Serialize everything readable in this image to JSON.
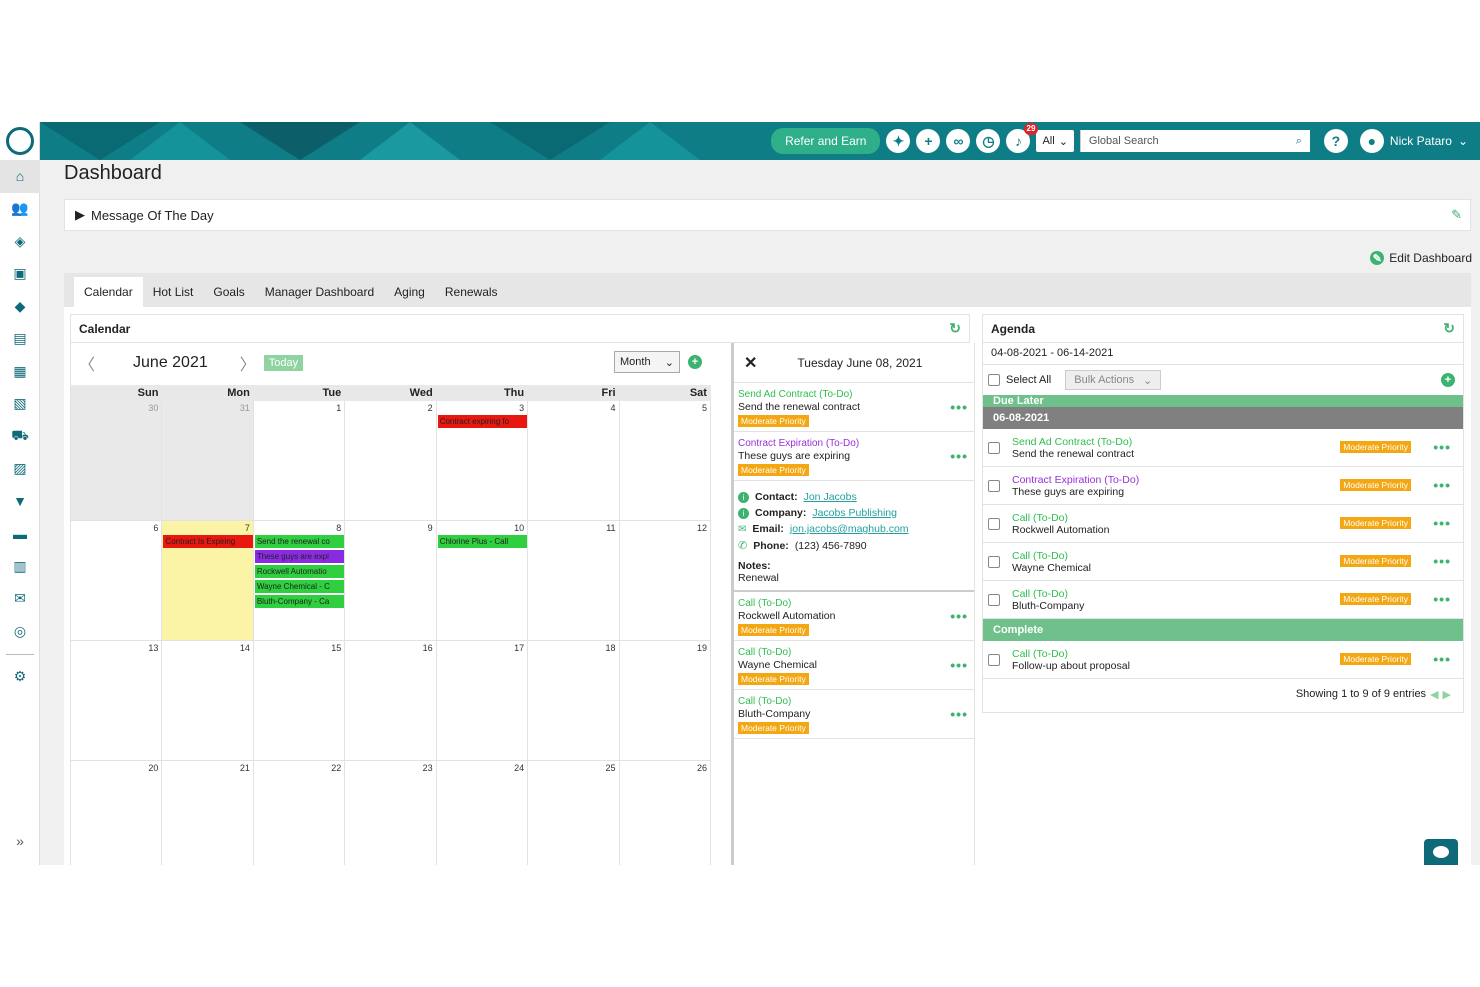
{
  "topbar": {
    "refer": "Refer and Earn",
    "notif_count": "29",
    "scope": "All",
    "search_placeholder": "Global Search",
    "user": "Nick Pataro"
  },
  "page": {
    "title": "Dashboard",
    "motd": "Message Of The Day",
    "edit": "Edit Dashboard"
  },
  "tabs": [
    {
      "label": "Calendar"
    },
    {
      "label": "Hot List"
    },
    {
      "label": "Goals"
    },
    {
      "label": "Manager Dashboard"
    },
    {
      "label": "Aging"
    },
    {
      "label": "Renewals"
    }
  ],
  "calendar": {
    "title": "Calendar",
    "month": "June 2021",
    "today": "Today",
    "view": "Month",
    "dow": [
      "Sun",
      "Mon",
      "Tue",
      "Wed",
      "Thu",
      "Fri",
      "Sat"
    ],
    "weeks": [
      [
        {
          "n": "30",
          "o": true
        },
        {
          "n": "31",
          "o": true
        },
        {
          "n": "1"
        },
        {
          "n": "2"
        },
        {
          "n": "3"
        },
        {
          "n": "4"
        },
        {
          "n": "5"
        }
      ],
      [
        {
          "n": "6"
        },
        {
          "n": "7"
        },
        {
          "n": "8"
        },
        {
          "n": "9"
        },
        {
          "n": "10"
        },
        {
          "n": "11"
        },
        {
          "n": "12"
        }
      ],
      [
        {
          "n": "13"
        },
        {
          "n": "14"
        },
        {
          "n": "15"
        },
        {
          "n": "16"
        },
        {
          "n": "17"
        },
        {
          "n": "18"
        },
        {
          "n": "19"
        }
      ],
      [
        {
          "n": "20"
        },
        {
          "n": "21"
        },
        {
          "n": "22"
        },
        {
          "n": "23"
        },
        {
          "n": "24"
        },
        {
          "n": "25"
        },
        {
          "n": "26"
        }
      ]
    ],
    "events": [
      {
        "week": 0,
        "day": 4,
        "label": "Contract expiring fo",
        "color": "#e8170f"
      },
      {
        "week": 1,
        "day": 1,
        "label": "Contract Is Expiring",
        "color": "#e8170f"
      },
      {
        "week": 1,
        "day": 2,
        "label": "Send the renewal co",
        "color": "#2fcf3f"
      },
      {
        "week": 1,
        "day": 2,
        "label": "These guys are expi",
        "color": "#8a2be2"
      },
      {
        "week": 1,
        "day": 2,
        "label": "Rockwell Automatio",
        "color": "#2fcf3f"
      },
      {
        "week": 1,
        "day": 2,
        "label": "Wayne Chemical - C",
        "color": "#2fcf3f"
      },
      {
        "week": 1,
        "day": 2,
        "label": "Bluth-Company - Ca",
        "color": "#2fcf3f"
      },
      {
        "week": 1,
        "day": 4,
        "label": "Chlorine Plus - Call",
        "color": "#2fcf3f"
      }
    ]
  },
  "detail": {
    "date": "Tuesday June 08, 2021",
    "items_top": [
      {
        "title": "Send Ad Contract (To-Do)",
        "sub": "Send the renewal contract",
        "prio": "Moderate Priority",
        "color": "#2fbf4f"
      },
      {
        "title": "Contract Expiration (To-Do)",
        "sub": "These guys are expiring",
        "prio": "Moderate Priority",
        "color": "#9a30d8"
      }
    ],
    "contact": {
      "contact_label": "Contact:",
      "contact": "Jon Jacobs",
      "company_label": "Company:",
      "company": "Jacobs Publishing",
      "email_label": "Email:",
      "email": "jon.jacobs@maghub.com",
      "phone_label": "Phone:",
      "phone": "(123) 456-7890",
      "notes_label": "Notes:",
      "notes": "Renewal"
    },
    "items_bottom": [
      {
        "title": "Call (To-Do)",
        "sub": "Rockwell Automation",
        "prio": "Moderate Priority",
        "color": "#2fbf4f"
      },
      {
        "title": "Call (To-Do)",
        "sub": "Wayne Chemical",
        "prio": "Moderate Priority",
        "color": "#2fbf4f"
      },
      {
        "title": "Call (To-Do)",
        "sub": "Bluth-Company",
        "prio": "Moderate Priority",
        "color": "#2fbf4f"
      }
    ]
  },
  "agenda": {
    "title": "Agenda",
    "range": "04-08-2021 - 06-14-2021",
    "select_all": "Select All",
    "bulk": "Bulk Actions",
    "due_later": "Due Later",
    "date_group": "06-08-2021",
    "complete": "Complete",
    "rows": [
      {
        "title": "Send Ad Contract (To-Do)",
        "sub": "Send the renewal contract",
        "prio": "Moderate Priority",
        "color": "#2fbf4f"
      },
      {
        "title": "Contract Expiration (To-Do)",
        "sub": "These guys are expiring",
        "prio": "Moderate Priority",
        "color": "#9a30d8"
      },
      {
        "title": "Call (To-Do)",
        "sub": "Rockwell Automation",
        "prio": "Moderate Priority",
        "color": "#2fbf4f"
      },
      {
        "title": "Call (To-Do)",
        "sub": "Wayne Chemical",
        "prio": "Moderate Priority",
        "color": "#2fbf4f"
      },
      {
        "title": "Call (To-Do)",
        "sub": "Bluth-Company",
        "prio": "Moderate Priority",
        "color": "#2fbf4f"
      }
    ],
    "complete_rows": [
      {
        "title": "Call (To-Do)",
        "sub": "Follow-up about proposal",
        "prio": "Moderate Priority",
        "color": "#2fbf4f"
      }
    ],
    "footer": "Showing 1 to 9 of 9 entries"
  },
  "colors": {
    "brand": "#0e7d86",
    "accent": "#3cb371",
    "priority": "#f3a712"
  }
}
